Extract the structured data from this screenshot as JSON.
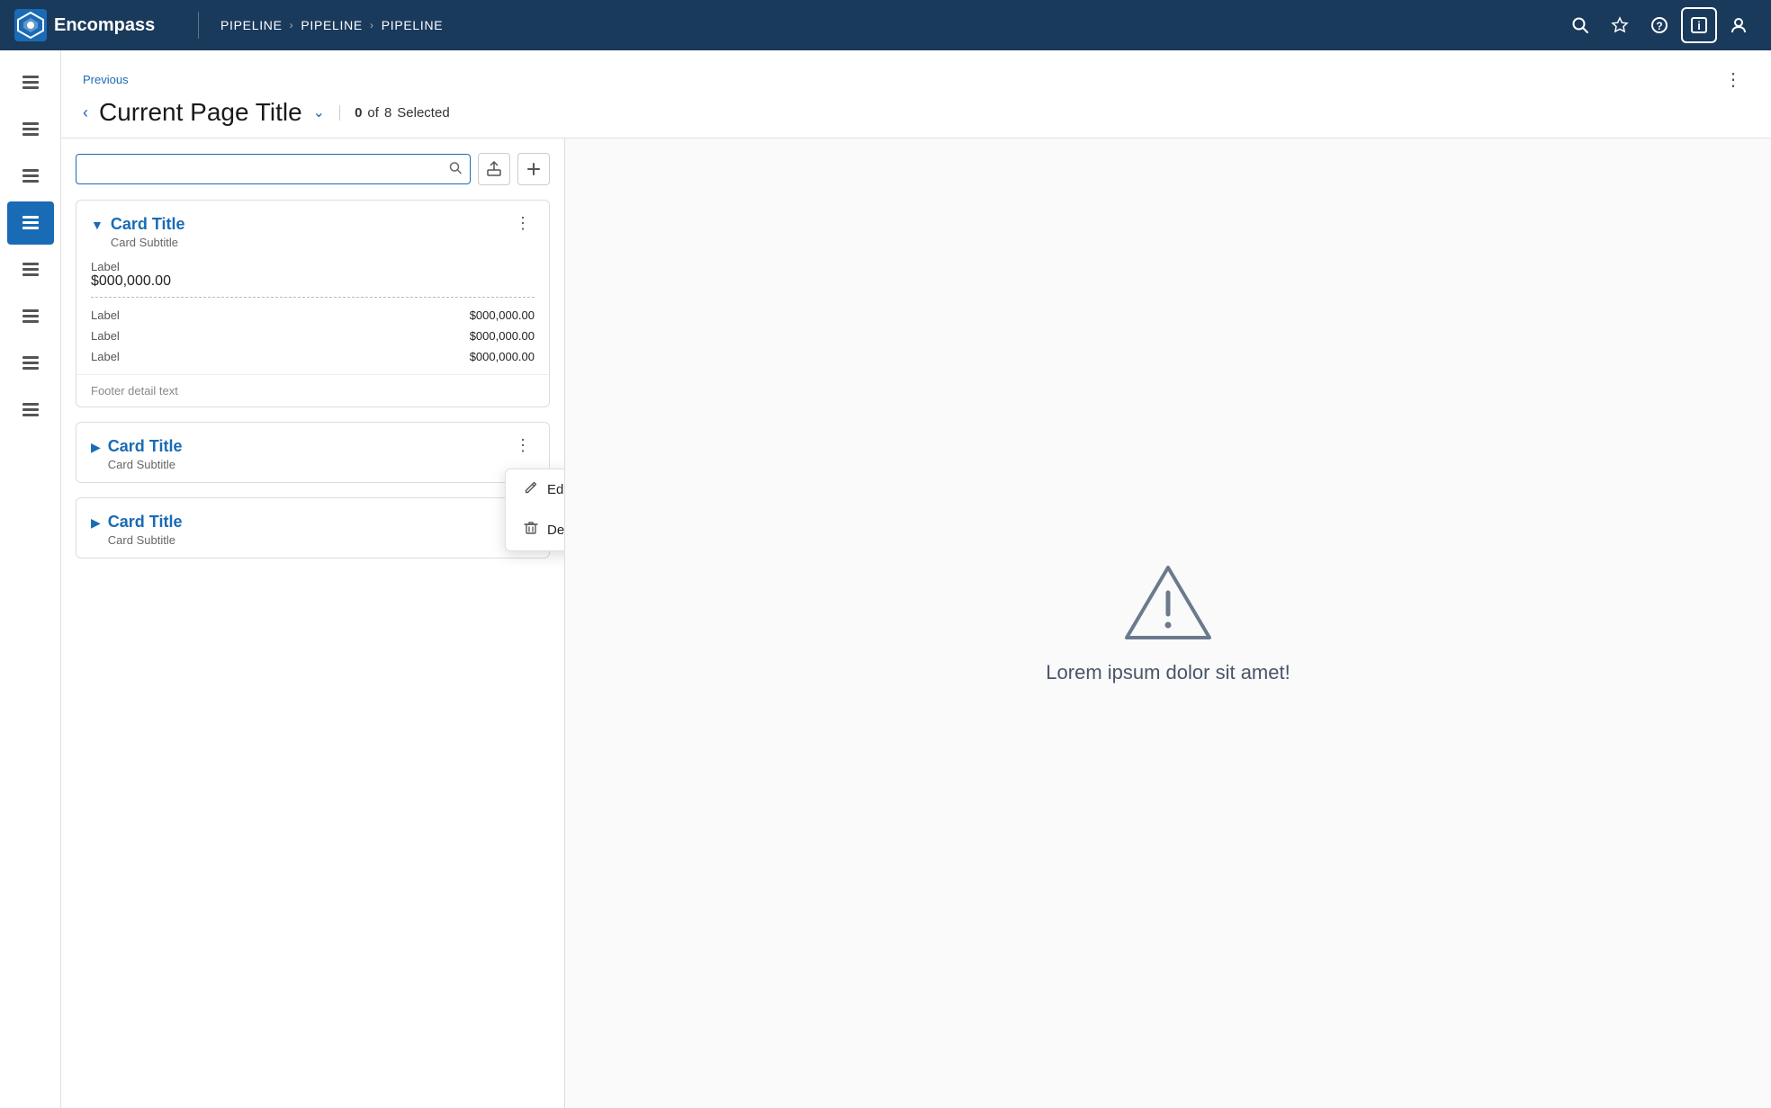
{
  "app": {
    "name": "Encompass",
    "logo_alt": "Encompass logo"
  },
  "breadcrumb": {
    "items": [
      "PIPELINE",
      "PIPELINE",
      "PIPELINE"
    ]
  },
  "nav_icons": [
    {
      "name": "search-icon",
      "symbol": "○"
    },
    {
      "name": "star-icon",
      "symbol": "☆"
    },
    {
      "name": "help-icon",
      "symbol": "?"
    },
    {
      "name": "info-icon",
      "symbol": "ℹ"
    },
    {
      "name": "user-icon",
      "symbol": "👤"
    }
  ],
  "sidebar": {
    "items": [
      {
        "id": "item-1",
        "label": "List view 1"
      },
      {
        "id": "item-2",
        "label": "List view 2"
      },
      {
        "id": "item-3",
        "label": "List view 3"
      },
      {
        "id": "item-4",
        "label": "List view 4",
        "active": true
      },
      {
        "id": "item-5",
        "label": "List view 5"
      },
      {
        "id": "item-6",
        "label": "List view 6"
      },
      {
        "id": "item-7",
        "label": "List view 7"
      },
      {
        "id": "item-8",
        "label": "List view 8"
      }
    ]
  },
  "page": {
    "previous_label": "Previous",
    "title": "Current Page Title",
    "selection_count": "0",
    "selection_total": "8",
    "selection_label": "Selected"
  },
  "search": {
    "placeholder": "",
    "value": ""
  },
  "toolbar": {
    "export_label": "Export",
    "add_label": "Add"
  },
  "cards": [
    {
      "id": "card-1",
      "expanded": true,
      "title": "Card Title",
      "subtitle": "Card Subtitle",
      "main_label": "Label",
      "main_value": "$000,000.00",
      "rows": [
        {
          "label": "Label",
          "value": "$000,000.00"
        },
        {
          "label": "Label",
          "value": "$000,000.00"
        },
        {
          "label": "Label",
          "value": "$000,000.00"
        }
      ],
      "footer": "Footer detail text"
    },
    {
      "id": "card-2",
      "expanded": false,
      "title": "Card Title",
      "subtitle": "Card Subtitle",
      "has_menu": true
    },
    {
      "id": "card-3",
      "expanded": false,
      "title": "Card Title",
      "subtitle": "Card Subtitle",
      "has_menu": false
    }
  ],
  "context_menu": {
    "visible": true,
    "card_index": 1,
    "items": [
      {
        "id": "edit",
        "label": "Edit",
        "icon": "✏️"
      },
      {
        "id": "delete",
        "label": "Delete",
        "icon": "🗑"
      }
    ]
  },
  "right_panel": {
    "warning_text": "Lorem ipsum dolor sit amet!"
  }
}
